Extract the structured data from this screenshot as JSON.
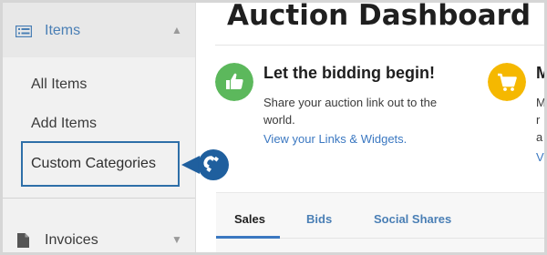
{
  "sidebar": {
    "section_label": "Items",
    "items": [
      {
        "label": "All Items"
      },
      {
        "label": "Add Items"
      },
      {
        "label": "Custom Categories"
      }
    ],
    "invoices_label": "Invoices"
  },
  "main": {
    "title": "Auction Dashboard",
    "cards": [
      {
        "title": "Let the bidding begin!",
        "text_line1": "Share your auction link out to the",
        "text_line2": "world.",
        "link": "View your Links & Widgets."
      },
      {
        "title": "M",
        "text_line1": "M",
        "text_line2": "r",
        "text_line3": "a",
        "link": "Vi"
      }
    ],
    "tabs": [
      {
        "label": "Sales"
      },
      {
        "label": "Bids"
      },
      {
        "label": "Social Shares"
      }
    ]
  },
  "colors": {
    "accent": "#3b78c1",
    "green": "#5cb85c",
    "yellow": "#f5b800",
    "highlight_border": "#2e6fa8"
  },
  "icons": {
    "items": "list-icon",
    "invoices": "document-icon",
    "card1": "thumbs-up-icon",
    "card2": "cart-icon",
    "callout": "magnet-icon"
  }
}
